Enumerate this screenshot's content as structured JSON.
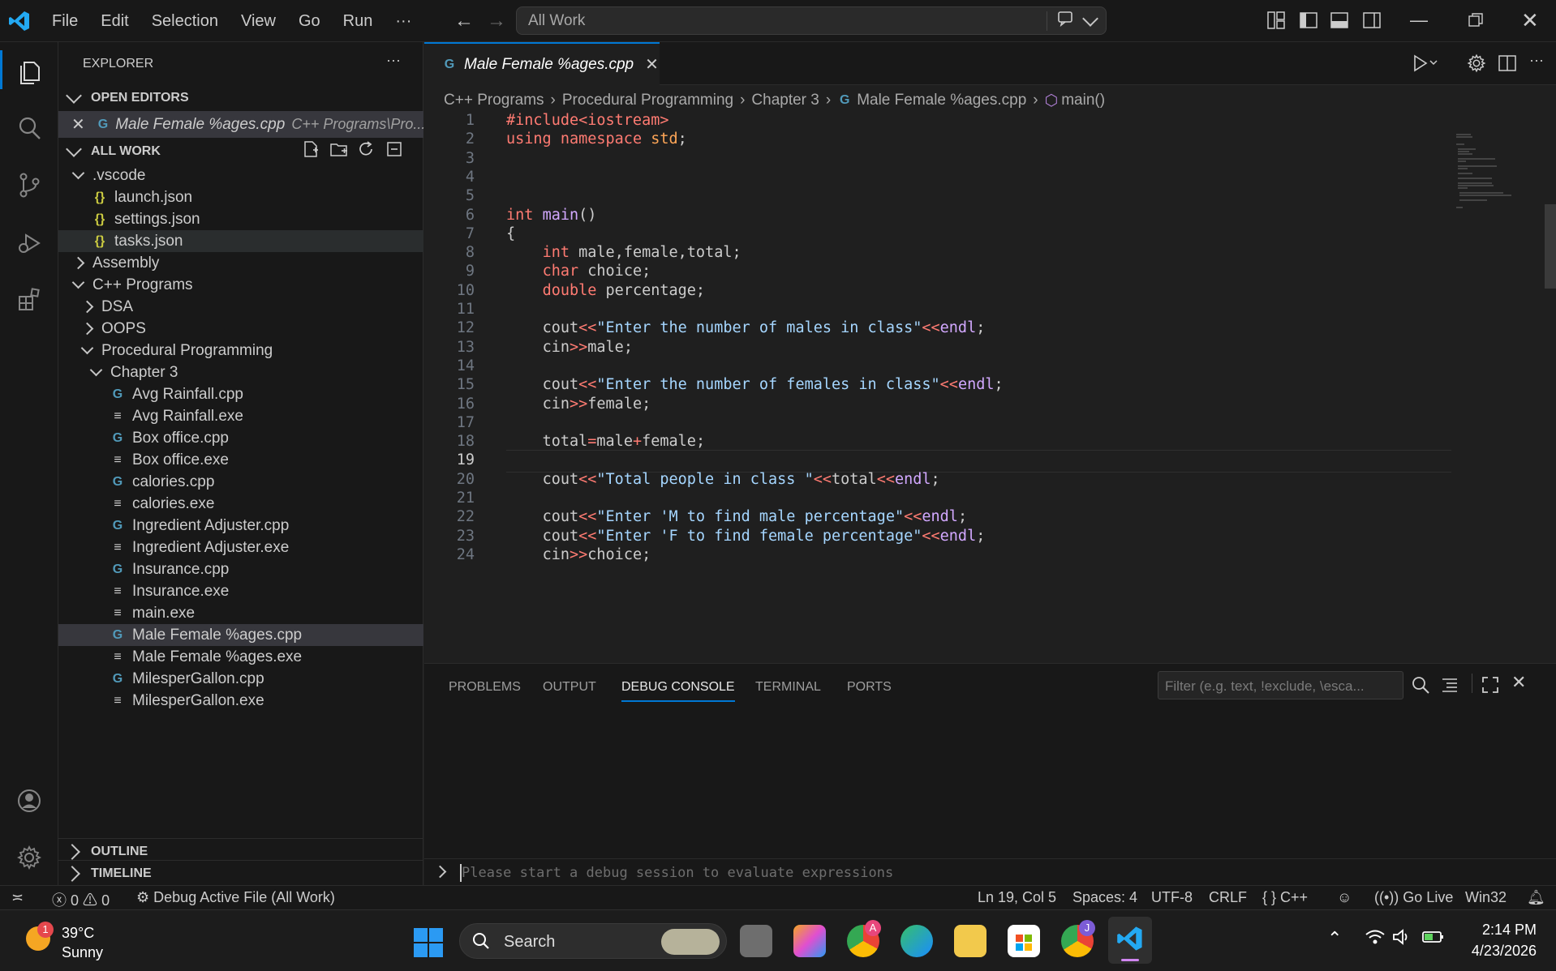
{
  "menu": {
    "items": [
      "File",
      "Edit",
      "Selection",
      "View",
      "Go",
      "Run",
      "···"
    ]
  },
  "command_center": {
    "text": "All Work"
  },
  "explorer": {
    "title": "EXPLORER",
    "more": "···",
    "open_editors_label": "OPEN EDITORS",
    "open_editor": {
      "name": "Male Female %ages.cpp",
      "path": "C++ Programs\\Pro..."
    },
    "workspace_label": "ALL WORK",
    "tree": [
      {
        "label": ".vscode",
        "kind": "folder-open",
        "level": 1
      },
      {
        "label": "launch.json",
        "kind": "json",
        "level": 2
      },
      {
        "label": "settings.json",
        "kind": "json",
        "level": 2
      },
      {
        "label": "tasks.json",
        "kind": "json",
        "level": 2
      },
      {
        "label": "Assembly",
        "kind": "folder",
        "level": 1
      },
      {
        "label": "C++ Programs",
        "kind": "folder-open",
        "level": 1
      },
      {
        "label": "DSA",
        "kind": "folder",
        "level": 2
      },
      {
        "label": "OOPS",
        "kind": "folder",
        "level": 2
      },
      {
        "label": "Procedural Programming",
        "kind": "folder-open",
        "level": 2
      },
      {
        "label": "Chapter 3",
        "kind": "folder-open",
        "level": 3
      },
      {
        "label": "Avg Rainfall.cpp",
        "kind": "cpp",
        "level": 4
      },
      {
        "label": "Avg Rainfall.exe",
        "kind": "exe",
        "level": 4
      },
      {
        "label": "Box office.cpp",
        "kind": "cpp",
        "level": 4
      },
      {
        "label": "Box office.exe",
        "kind": "exe",
        "level": 4
      },
      {
        "label": "calories.cpp",
        "kind": "cpp",
        "level": 4
      },
      {
        "label": "calories.exe",
        "kind": "exe",
        "level": 4
      },
      {
        "label": "Ingredient Adjuster.cpp",
        "kind": "cpp",
        "level": 4
      },
      {
        "label": "Ingredient Adjuster.exe",
        "kind": "exe",
        "level": 4
      },
      {
        "label": "Insurance.cpp",
        "kind": "cpp",
        "level": 4
      },
      {
        "label": "Insurance.exe",
        "kind": "exe",
        "level": 4
      },
      {
        "label": "main.exe",
        "kind": "exe",
        "level": 4
      },
      {
        "label": "Male Female %ages.cpp",
        "kind": "cpp",
        "level": 4,
        "selected": true
      },
      {
        "label": "Male Female %ages.exe",
        "kind": "exe",
        "level": 4
      },
      {
        "label": "MilesperGallon.cpp",
        "kind": "cpp",
        "level": 4
      },
      {
        "label": "MilesperGallon.exe",
        "kind": "exe",
        "level": 4
      }
    ],
    "outline_label": "OUTLINE",
    "timeline_label": "TIMELINE"
  },
  "editor": {
    "tab_label": "Male Female %ages.cpp",
    "breadcrumbs": [
      "C++ Programs",
      "Procedural Programming",
      "Chapter 3",
      "Male Female %ages.cpp",
      "main()"
    ],
    "current_line": 19,
    "lines": [
      "#include<iostream>",
      "using namespace std;",
      "",
      "",
      "",
      "int main()",
      "{",
      "    int male,female,total;",
      "    char choice;",
      "    double percentage;",
      "",
      "    cout<<\"Enter the number of males in class\"<<endl;",
      "    cin>>male;",
      "",
      "    cout<<\"Enter the number of females in class\"<<endl;",
      "    cin>>female;",
      "",
      "    total=male+female;",
      "",
      "    cout<<\"Total people in class \"<<total<<endl;",
      "",
      "    cout<<\"Enter 'M to find male percentage\"<<endl;",
      "    cout<<\"Enter 'F to find female percentage\"<<endl;",
      "    cin>>choice;"
    ]
  },
  "panel": {
    "tabs": [
      "PROBLEMS",
      "OUTPUT",
      "DEBUG CONSOLE",
      "TERMINAL",
      "PORTS"
    ],
    "active_tab": "DEBUG CONSOLE",
    "filter_placeholder": "Filter (e.g. text, !exclude, \\esca...",
    "input_placeholder": "Please start a debug session to evaluate expressions"
  },
  "status": {
    "errors": "0",
    "warnings": "0",
    "debug": "Debug Active File (All Work)",
    "position": "Ln 19, Col 5",
    "spaces": "Spaces: 4",
    "encoding": "UTF-8",
    "eol": "CRLF",
    "language": "C++",
    "golive": "Go Live",
    "platform": "Win32"
  },
  "taskbar": {
    "weather_temp": "39°C",
    "weather_desc": "Sunny",
    "weather_badge": "1",
    "search": "Search",
    "time": "2:14 PM",
    "date": "4/23/2026",
    "chrome_badge_a": "A",
    "chrome_badge_j": "J"
  },
  "colors": {
    "accent": "#0078d4",
    "vscode_blue": "#23a9f2"
  }
}
